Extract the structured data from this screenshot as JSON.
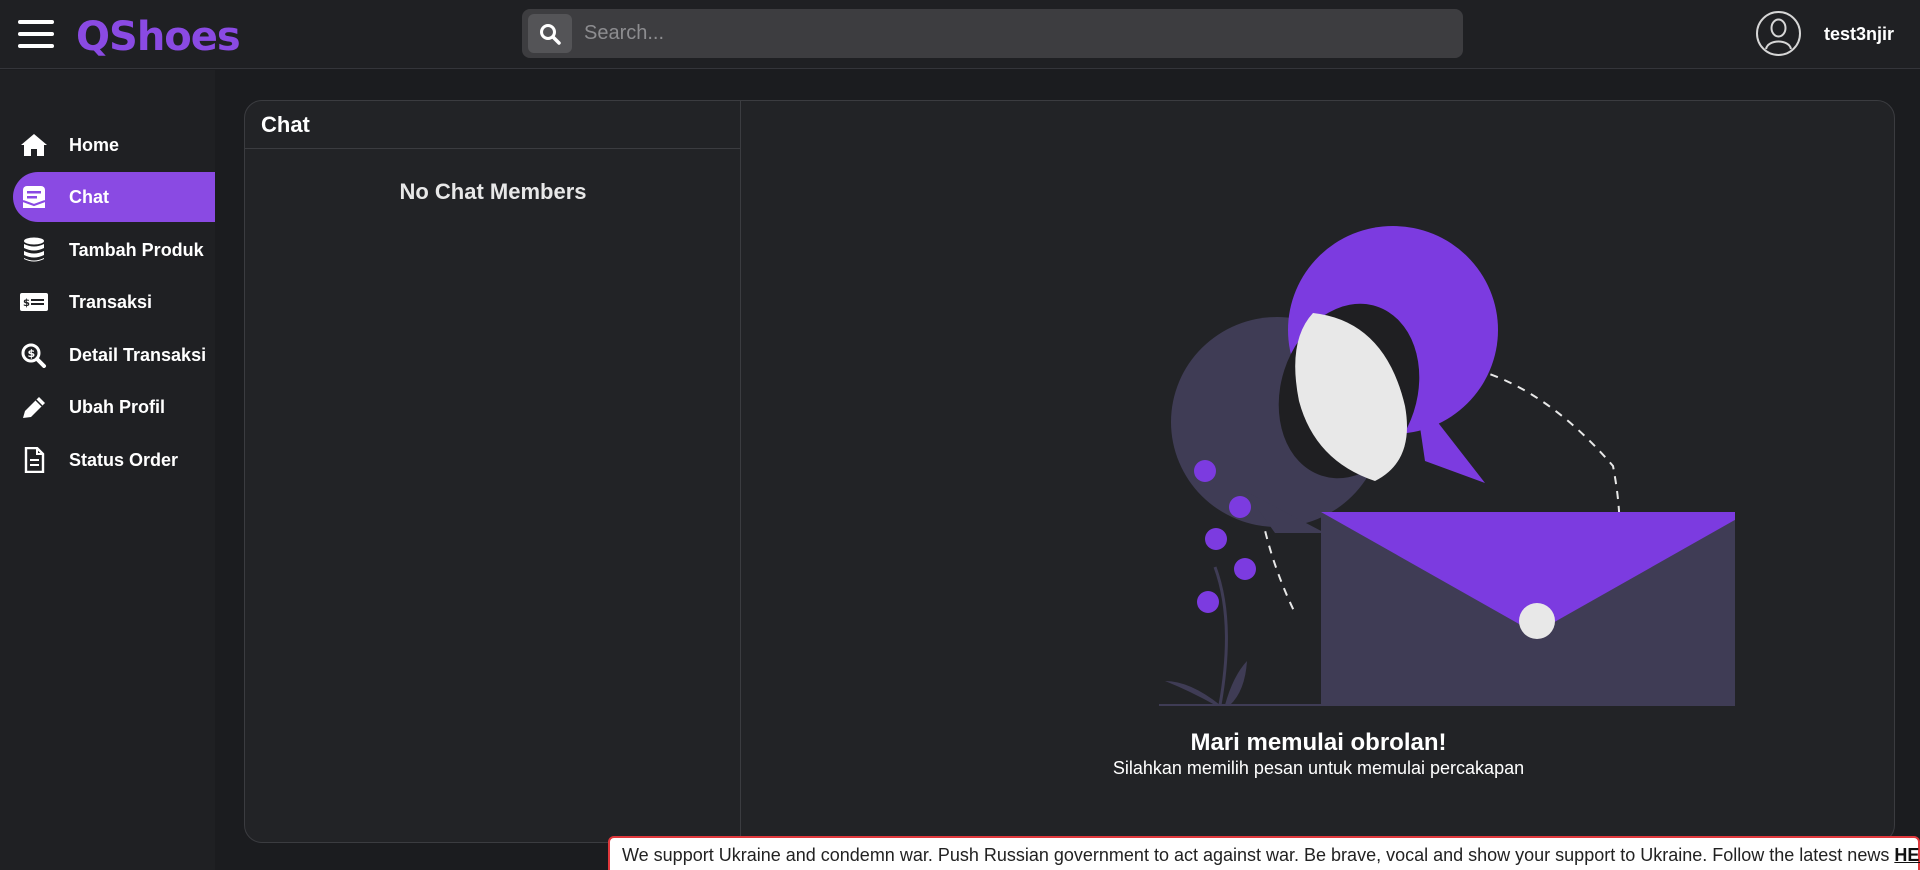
{
  "header": {
    "logo": "QShoes",
    "search_placeholder": "Search...",
    "username": "test3njir"
  },
  "sidebar": {
    "items": [
      {
        "label": "Home",
        "icon": "home-icon"
      },
      {
        "label": "Chat",
        "icon": "chat-icon",
        "active": true
      },
      {
        "label": "Tambah Produk",
        "icon": "database-icon"
      },
      {
        "label": "Transaksi",
        "icon": "money-check-icon"
      },
      {
        "label": "Detail Transaksi",
        "icon": "search-dollar-icon"
      },
      {
        "label": "Ubah Profil",
        "icon": "pencil-icon"
      },
      {
        "label": "Status Order",
        "icon": "document-icon"
      }
    ]
  },
  "chat": {
    "title": "Chat",
    "empty_members": "No Chat Members",
    "empty_title": "Mari memulai obrolan!",
    "empty_subtitle": "Silahkan memilih pesan untuk memulai percakapan"
  },
  "banner": {
    "text": "We support Ukraine and condemn war. Push Russian government to act against war. Be brave, vocal and show your support to Ukraine. Follow the latest news ",
    "link": "HERE"
  },
  "colors": {
    "accent": "#8a4ae3",
    "background": "#1b1c1f",
    "panel": "#222326"
  }
}
